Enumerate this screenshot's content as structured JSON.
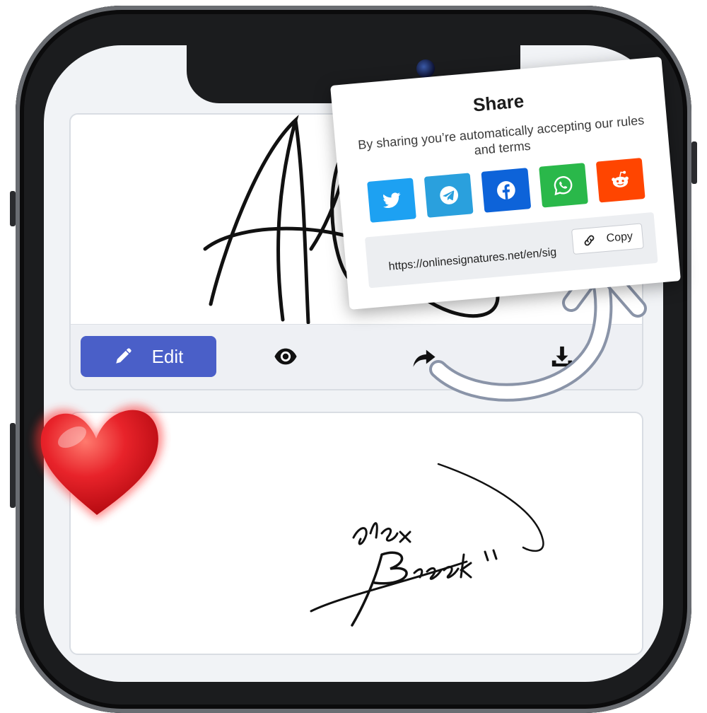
{
  "toolbar": {
    "edit_label": "Edit",
    "icons": [
      "pencil-icon",
      "eye-icon",
      "share-icon",
      "download-icon"
    ]
  },
  "share": {
    "title": "Share",
    "subtitle": "By sharing you’re automatically accepting our rules and terms",
    "socials": [
      {
        "name": "twitter",
        "color": "#1da1f2"
      },
      {
        "name": "telegram",
        "color": "#2aa0dd"
      },
      {
        "name": "facebook",
        "color": "#0d63d9"
      },
      {
        "name": "whatsapp",
        "color": "#2ab84a"
      },
      {
        "name": "reddit",
        "color": "#ff4500"
      }
    ],
    "url": "https://onlinesignatures.net/en/sig",
    "copy_label": "Copy"
  },
  "colors": {
    "edit_button": "#4a5fc8",
    "heart": "#e8232a"
  }
}
